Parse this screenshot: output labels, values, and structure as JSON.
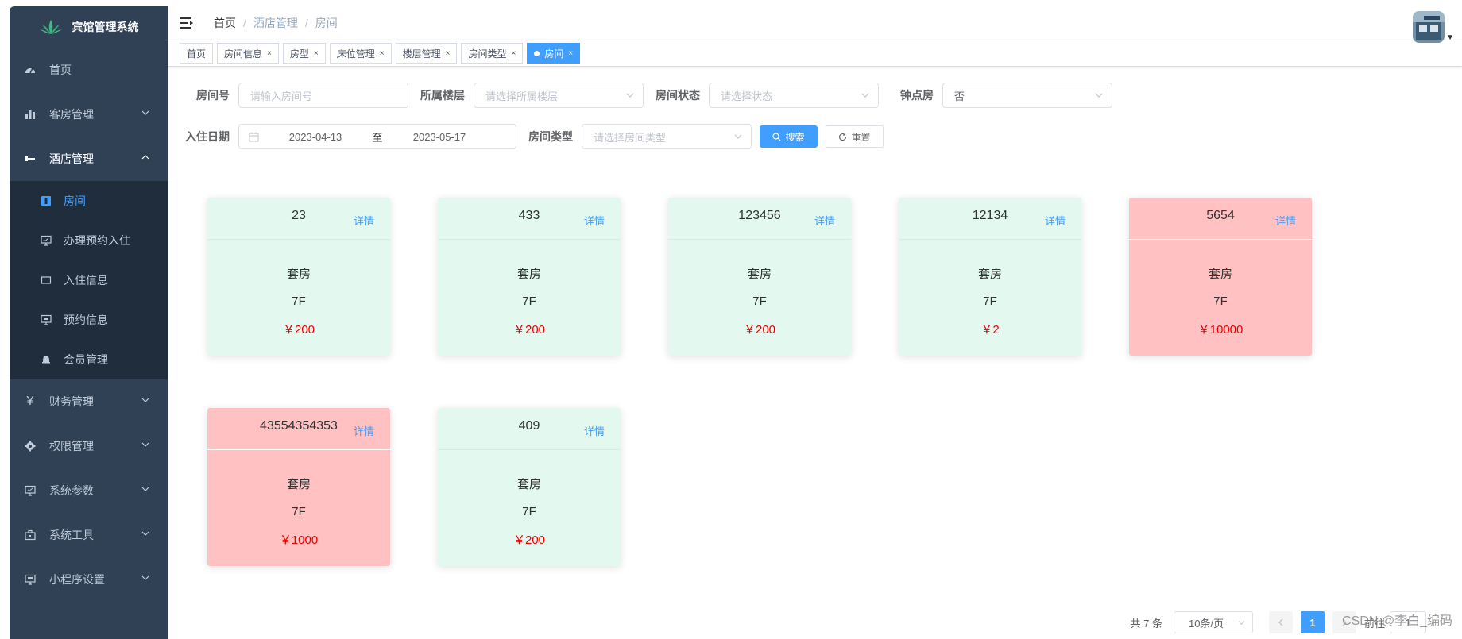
{
  "app": {
    "title": "宾馆管理系统"
  },
  "sidebar": {
    "items": [
      {
        "label": "首页",
        "icon": "dashboard-icon"
      },
      {
        "label": "客房管理",
        "icon": "chart-bar-icon"
      },
      {
        "label": "酒店管理",
        "icon": "minus-icon"
      }
    ],
    "sub_items": [
      {
        "label": "房间",
        "icon": "door-icon"
      },
      {
        "label": "办理预约入住",
        "icon": "monitor-icon"
      },
      {
        "label": "入住信息",
        "icon": "rect-icon"
      },
      {
        "label": "预约信息",
        "icon": "monitor-icon"
      },
      {
        "label": "会员管理",
        "icon": "bell-icon"
      }
    ],
    "bottom_items": [
      {
        "label": "财务管理",
        "icon": "yen-icon"
      },
      {
        "label": "权限管理",
        "icon": "gear-icon"
      },
      {
        "label": "系统参数",
        "icon": "monitor-icon"
      },
      {
        "label": "系统工具",
        "icon": "toolbox-icon"
      },
      {
        "label": "小程序设置",
        "icon": "monitor-icon"
      }
    ]
  },
  "breadcrumb": {
    "home": "首页",
    "sep": "/",
    "parent": "酒店管理",
    "current": "房间"
  },
  "tags": [
    {
      "label": "首页"
    },
    {
      "label": "房间信息"
    },
    {
      "label": "房型"
    },
    {
      "label": "床位管理"
    },
    {
      "label": "楼层管理"
    },
    {
      "label": "房间类型"
    },
    {
      "label": "房间"
    }
  ],
  "tag_close": "×",
  "filters": {
    "room_no_label": "房间号",
    "room_no_placeholder": "请输入房间号",
    "floor_label": "所属楼层",
    "floor_placeholder": "请选择所属楼层",
    "status_label": "房间状态",
    "status_placeholder": "请选择状态",
    "hourly_label": "钟点房",
    "hourly_value": "否",
    "date_label": "入住日期",
    "date_start": "2023-04-13",
    "date_to": "至",
    "date_end": "2023-05-17",
    "type_label": "房间类型",
    "type_placeholder": "请选择房间类型",
    "search_btn": "搜索",
    "reset_btn": "重置"
  },
  "cards": [
    {
      "num": "23",
      "detail": "详情",
      "type": "套房",
      "floor": "7F",
      "price": "￥200",
      "status": "green"
    },
    {
      "num": "433",
      "detail": "详情",
      "type": "套房",
      "floor": "7F",
      "price": "￥200",
      "status": "green"
    },
    {
      "num": "123456",
      "detail": "详情",
      "type": "套房",
      "floor": "7F",
      "price": "￥200",
      "status": "green"
    },
    {
      "num": "12134",
      "detail": "详情",
      "type": "套房",
      "floor": "7F",
      "price": "￥2",
      "status": "green"
    },
    {
      "num": "5654",
      "detail": "详情",
      "type": "套房",
      "floor": "7F",
      "price": "￥10000",
      "status": "red"
    },
    {
      "num": "43554354353",
      "detail": "详情",
      "type": "套房",
      "floor": "7F",
      "price": "￥1000",
      "status": "red"
    },
    {
      "num": "409",
      "detail": "详情",
      "type": "套房",
      "floor": "7F",
      "price": "￥200",
      "status": "green"
    }
  ],
  "pagination": {
    "total": "共 7 条",
    "page_size": "10条/页",
    "current": "1",
    "goto_prefix": "前往",
    "goto_value": "1"
  },
  "watermark": "CSDN @李白_编码",
  "colors": {
    "sidebar_bg": "#304156",
    "submenu_bg": "#1f2d3d",
    "primary": "#409eff",
    "card_green": "#e3f8ee",
    "card_red": "#ffc1c1",
    "price": "#f00000"
  }
}
